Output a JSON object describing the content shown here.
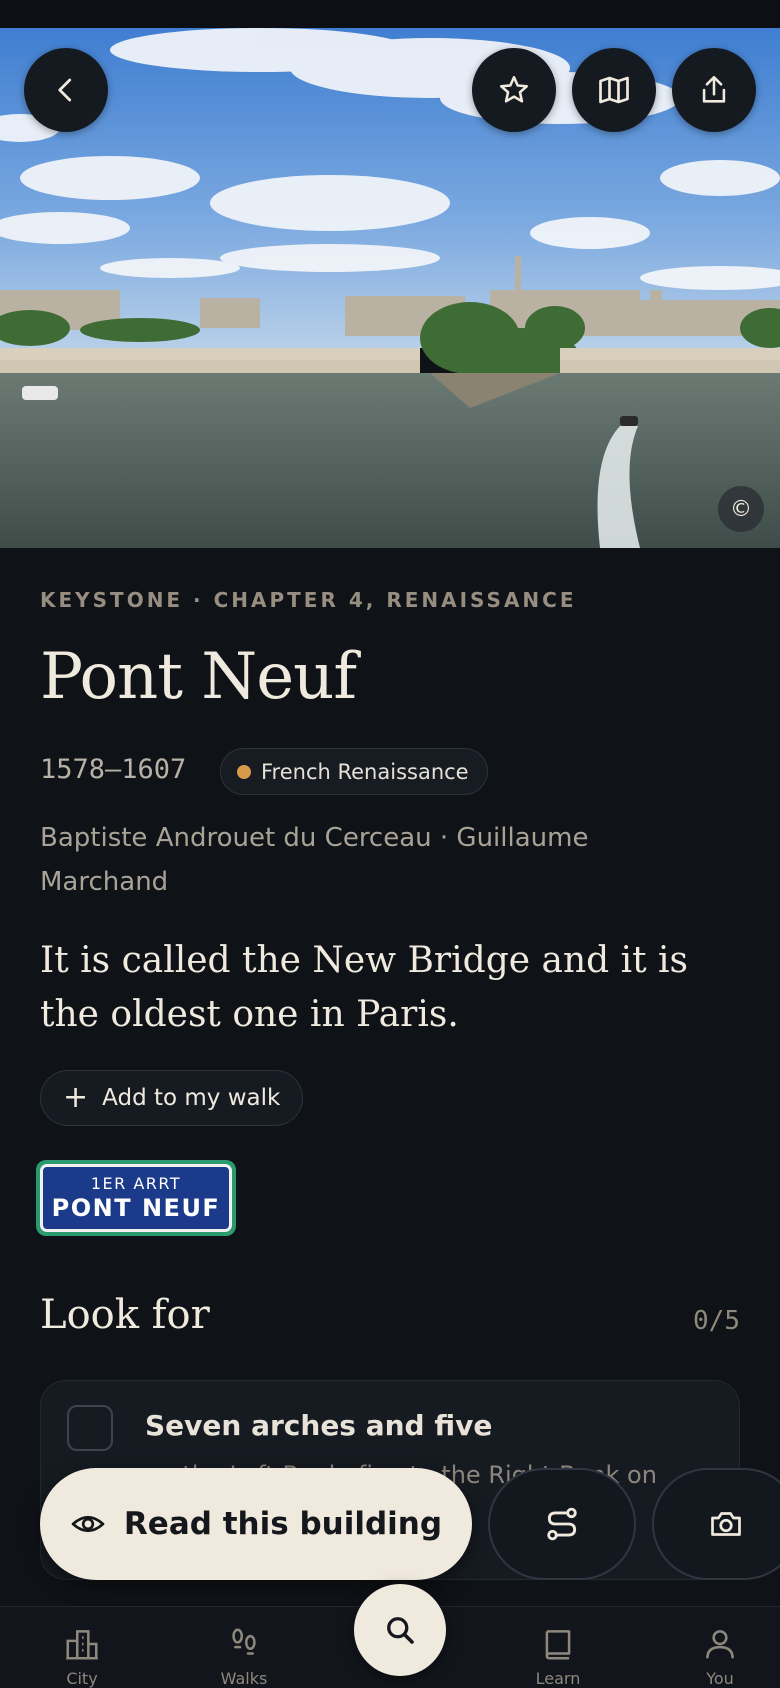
{
  "hero": {
    "image_description_icon": "photo",
    "copyright_symbol": "©"
  },
  "header_actions": {
    "back_icon": "chevron-left-icon",
    "favorite_icon": "star-icon",
    "map_icon": "map-icon",
    "share_icon": "share-icon"
  },
  "building": {
    "eyebrow": "KEYSTONE · CHAPTER 4, RENAISSANCE",
    "name": "Pont Neuf",
    "years": "1578–1607",
    "style": "French Renaissance",
    "style_color": "#d9994a",
    "architects": "Baptiste Androuet du Cerceau · Guillaume Marchand",
    "tagline": "It is called the New Bridge and it is the oldest one in Paris."
  },
  "walk": {
    "plus": "+",
    "label": "Add to my walk"
  },
  "street_sign": {
    "top": "1ER ARRT",
    "main": "PONT NEUF"
  },
  "look_for": {
    "title": "Look for",
    "count": "0/5",
    "items": [
      {
        "title": "Seven arches and five",
        "body": "on the Left Bank, five to the Right Bank on"
      }
    ]
  },
  "actions": {
    "read_label": "Read this building",
    "route_icon": "route-icon",
    "camera_icon": "camera-icon"
  },
  "tabs": [
    {
      "label": "City",
      "icon": "city-icon"
    },
    {
      "label": "Walks",
      "icon": "footsteps-icon"
    },
    {
      "label": "Learn",
      "icon": "book-icon"
    },
    {
      "label": "You",
      "icon": "person-icon"
    }
  ],
  "colors": {
    "background": "#0f1217",
    "accent_cream": "#f0e9dd",
    "sign_blue": "#1c3a8a",
    "sign_border": "#2b9a6f"
  }
}
